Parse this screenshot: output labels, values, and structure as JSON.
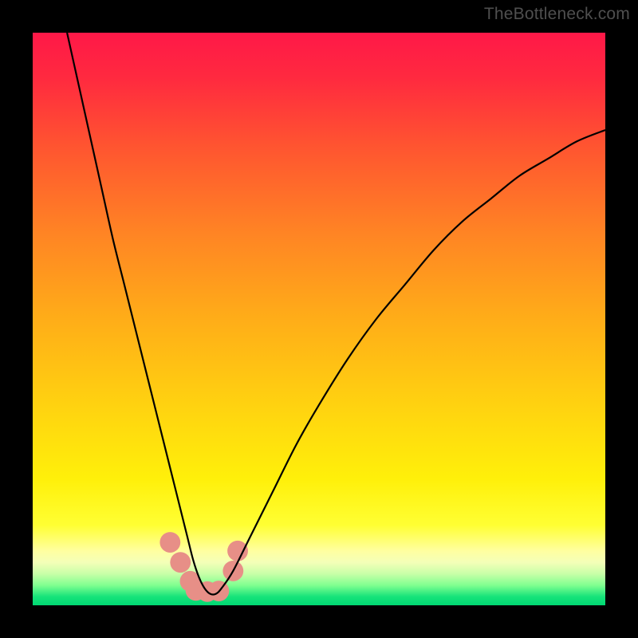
{
  "watermark": "TheBottleneck.com",
  "chart_data": {
    "type": "line",
    "title": "",
    "xlabel": "",
    "ylabel": "",
    "xlim": [
      0,
      100
    ],
    "ylim": [
      0,
      100
    ],
    "background_gradient_stops": [
      {
        "pos": 0.0,
        "color": "#ff1848"
      },
      {
        "pos": 0.08,
        "color": "#ff2a3f"
      },
      {
        "pos": 0.2,
        "color": "#ff5530"
      },
      {
        "pos": 0.35,
        "color": "#ff8424"
      },
      {
        "pos": 0.5,
        "color": "#ffad18"
      },
      {
        "pos": 0.65,
        "color": "#ffd210"
      },
      {
        "pos": 0.78,
        "color": "#fff00a"
      },
      {
        "pos": 0.86,
        "color": "#ffff33"
      },
      {
        "pos": 0.905,
        "color": "#ffffa0"
      },
      {
        "pos": 0.925,
        "color": "#f4ffb8"
      },
      {
        "pos": 0.945,
        "color": "#c8ffa8"
      },
      {
        "pos": 0.965,
        "color": "#80ff90"
      },
      {
        "pos": 0.985,
        "color": "#16e37a"
      },
      {
        "pos": 1.0,
        "color": "#00d873"
      }
    ],
    "series": [
      {
        "name": "bottleneck-curve",
        "color": "#000000",
        "x": [
          6,
          8,
          10,
          12,
          14,
          16,
          18,
          20,
          22,
          24,
          25,
          26,
          27,
          28,
          29,
          30,
          31,
          32,
          33,
          35,
          38,
          42,
          46,
          50,
          55,
          60,
          65,
          70,
          75,
          80,
          85,
          90,
          95,
          100
        ],
        "y": [
          100,
          91,
          82,
          73,
          64,
          56,
          48,
          40,
          32,
          24,
          20,
          16,
          12,
          8,
          5,
          3,
          2,
          2,
          3,
          6,
          12,
          20,
          28,
          35,
          43,
          50,
          56,
          62,
          67,
          71,
          75,
          78,
          81,
          83
        ]
      }
    ],
    "markers": {
      "name": "highlight-cluster",
      "color": "#e78f87",
      "points": [
        {
          "x": 24.0,
          "y": 11.0
        },
        {
          "x": 25.8,
          "y": 7.5
        },
        {
          "x": 27.5,
          "y": 4.2
        },
        {
          "x": 28.5,
          "y": 2.6
        },
        {
          "x": 30.5,
          "y": 2.4
        },
        {
          "x": 32.5,
          "y": 2.5
        },
        {
          "x": 35.0,
          "y": 6.0
        },
        {
          "x": 35.8,
          "y": 9.5
        }
      ],
      "radius_pct": 1.8
    }
  }
}
